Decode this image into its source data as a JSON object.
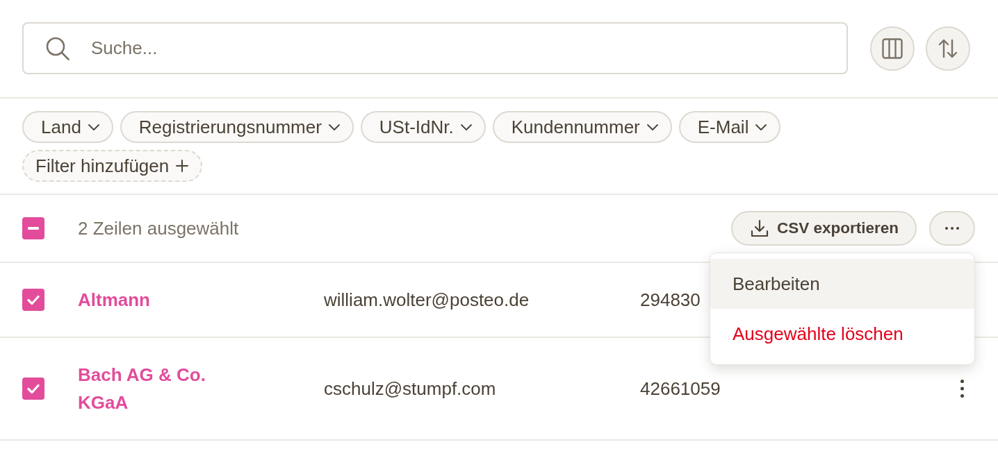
{
  "search": {
    "placeholder": "Suche..."
  },
  "filters": [
    {
      "kind": "dropdown",
      "label": "Land"
    },
    {
      "kind": "dropdown",
      "label": "Registrierungsnummer"
    },
    {
      "kind": "dropdown",
      "label": "USt-IdNr."
    },
    {
      "kind": "dropdown",
      "label": "Kundennummer"
    },
    {
      "kind": "dropdown",
      "label": "E-Mail"
    },
    {
      "kind": "add",
      "label": "Filter hinzufügen"
    }
  ],
  "selection_bar": {
    "indeterminate": true,
    "label": "2 Zeilen ausgewählt",
    "export_button": {
      "label": "CSV exportieren"
    }
  },
  "menu": {
    "open": true,
    "items": [
      {
        "kind": "normal",
        "label": "Bearbeiten",
        "highlighted": true
      },
      {
        "kind": "danger",
        "label": "Ausgewählte löschen",
        "highlighted": false
      }
    ]
  },
  "rows": [
    {
      "selected": true,
      "name": "Altmann",
      "email": "william.wolter@posteo.de",
      "number": "294830"
    },
    {
      "selected": true,
      "name": "Bach AG & Co. KGaA",
      "email": "cschulz@stumpf.com",
      "number": "42661059"
    }
  ]
}
